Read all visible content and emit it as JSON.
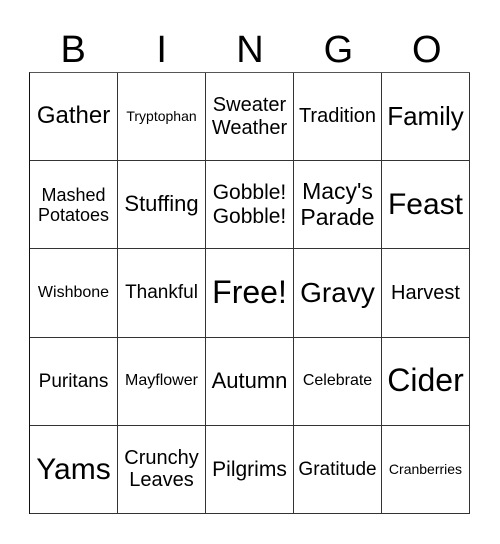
{
  "header": [
    "B",
    "I",
    "N",
    "G",
    "O"
  ],
  "cells": [
    {
      "text": "Gather",
      "size": 24
    },
    {
      "text": "Tryptophan",
      "size": 14
    },
    {
      "text": "Sweater\nWeather",
      "size": 20
    },
    {
      "text": "Tradition",
      "size": 20
    },
    {
      "text": "Family",
      "size": 26
    },
    {
      "text": "Mashed\nPotatoes",
      "size": 18
    },
    {
      "text": "Stuffing",
      "size": 22
    },
    {
      "text": "Gobble!\nGobble!",
      "size": 21
    },
    {
      "text": "Macy's\nParade",
      "size": 23
    },
    {
      "text": "Feast",
      "size": 30
    },
    {
      "text": "Wishbone",
      "size": 16
    },
    {
      "text": "Thankful",
      "size": 19
    },
    {
      "text": "Free!",
      "size": 32
    },
    {
      "text": "Gravy",
      "size": 28
    },
    {
      "text": "Harvest",
      "size": 20
    },
    {
      "text": "Puritans",
      "size": 19
    },
    {
      "text": "Mayflower",
      "size": 16
    },
    {
      "text": "Autumn",
      "size": 22
    },
    {
      "text": "Celebrate",
      "size": 16
    },
    {
      "text": "Cider",
      "size": 32
    },
    {
      "text": "Yams",
      "size": 30
    },
    {
      "text": "Crunchy\nLeaves",
      "size": 20
    },
    {
      "text": "Pilgrims",
      "size": 21
    },
    {
      "text": "Gratitude",
      "size": 19
    },
    {
      "text": "Cranberries",
      "size": 14
    }
  ]
}
